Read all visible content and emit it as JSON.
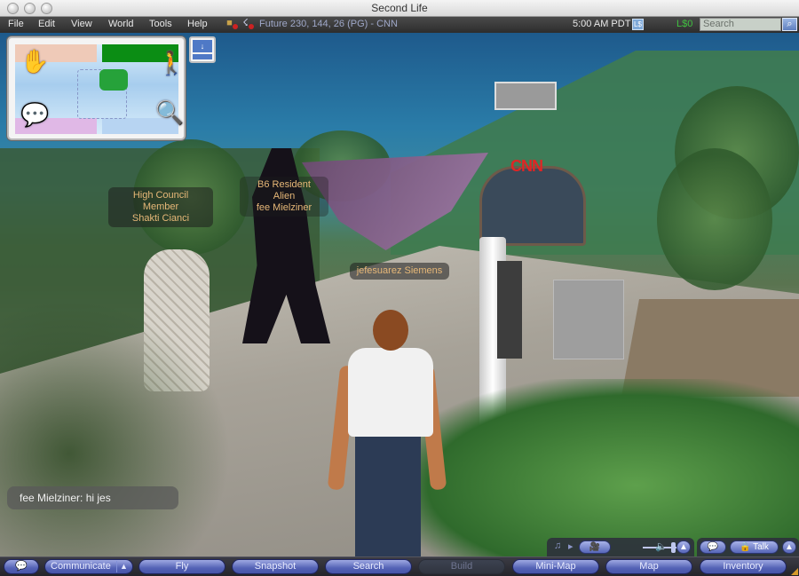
{
  "window": {
    "title": "Second Life"
  },
  "menubar": {
    "items": [
      "File",
      "Edit",
      "View",
      "World",
      "Tools",
      "Help"
    ],
    "location": {
      "icons": [
        "no-build-icon",
        "no-push-icon"
      ],
      "text": "Future 230, 144, 26 (PG) - CNN"
    },
    "clock": "5:00 AM PDT",
    "buy_currency_icon": "L$",
    "balance": "L$0",
    "search_placeholder": "Search",
    "search_button_icon": "⌕"
  },
  "toolbox": {
    "quadrants": [
      {
        "name": "edit",
        "icon": "hand-shirt-icon"
      },
      {
        "name": "move",
        "icon": "walking-person-icon"
      },
      {
        "name": "chat",
        "icon": "speech-person-icon"
      },
      {
        "name": "search",
        "icon": "magnifier-icon"
      }
    ],
    "center_icon": "puzzle-icon",
    "collapse_icon": "↓"
  },
  "scene": {
    "name_tags": [
      {
        "id": "shakti",
        "lines": [
          "High Council Member",
          "Shakti Cianci"
        ]
      },
      {
        "id": "fee",
        "lines": [
          "B6 Resident Alien",
          "fee Mielziner"
        ]
      },
      {
        "id": "jefe",
        "lines": [
          "jefesuarez Siemens"
        ]
      }
    ],
    "sign_text": "CNN",
    "chat_line": "fee Mielziner: hi jes"
  },
  "media_controls": {
    "music_icon": "♫",
    "play_icon": "▸",
    "movie_icon": "🎥",
    "volume_level": 0.85,
    "mute_icon": "🔈",
    "expand_icon": "▲"
  },
  "voice_controls": {
    "speakers_icon": "💬",
    "talk_label": "Talk",
    "lock_icon": "🔒",
    "expand_icon": "▲"
  },
  "toolbar": {
    "chat_icon": "💬",
    "communicate": "Communicate",
    "communicate_arrow": "▲",
    "buttons": [
      {
        "id": "fly",
        "label": "Fly",
        "enabled": true
      },
      {
        "id": "snapshot",
        "label": "Snapshot",
        "enabled": true
      },
      {
        "id": "search",
        "label": "Search",
        "enabled": true
      },
      {
        "id": "build",
        "label": "Build",
        "enabled": false
      },
      {
        "id": "mini-map",
        "label": "Mini-Map",
        "enabled": true
      },
      {
        "id": "map",
        "label": "Map",
        "enabled": true
      },
      {
        "id": "inventory",
        "label": "Inventory",
        "enabled": true
      }
    ]
  }
}
